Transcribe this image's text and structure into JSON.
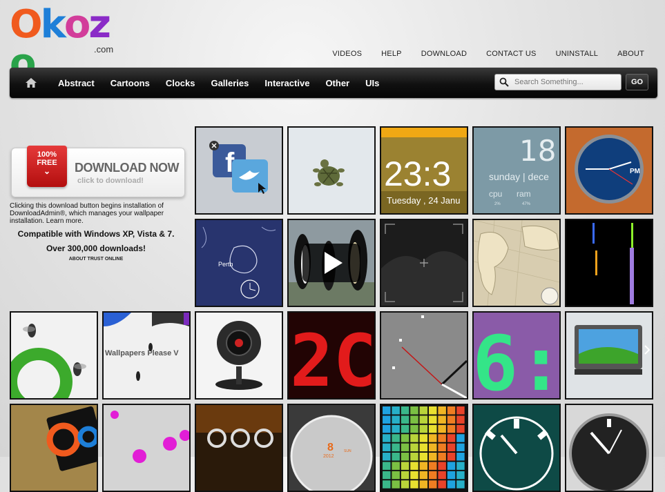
{
  "logo": {
    "letters": [
      "O",
      "k",
      "o",
      "z",
      "o"
    ],
    "suffix": ".com"
  },
  "top_links": [
    "VIDEOS",
    "HELP",
    "DOWNLOAD",
    "CONTACT US",
    "UNINSTALL",
    "ABOUT"
  ],
  "nav": {
    "items": [
      "Abstract",
      "Cartoons",
      "Clocks",
      "Galleries",
      "Interactive",
      "Other",
      "UIs"
    ]
  },
  "search": {
    "placeholder": "Search Something...",
    "button": "GO"
  },
  "download": {
    "ribbon_percent": "100%",
    "ribbon_free": "FREE",
    "title": "DOWNLOAD NOW",
    "subtitle": "click to download!",
    "description": "Clicking this download button begins installation of DownloadAdmin®, which manages your wallpaper installation. Learn more.",
    "compat": "Compatible with Windows XP, Vista & 7.",
    "downloads": "Over 300,000 downloads!",
    "trust": "ABOUT TRUST ONLINE"
  },
  "tiles": {
    "clock_time": "23:3",
    "clock_date": "Tuesday , 24 Janu",
    "weather_num": "18",
    "weather_day": "sunday | dece",
    "weather_cpu": "cpu",
    "weather_ram": "ram",
    "weather_cpu_val": "2%",
    "weather_ram_val": "47%",
    "map_city": "Perth",
    "ants_text": "Wallpapers Please V",
    "red_digits": "2C",
    "green_digits": "6:",
    "pm": "PM",
    "calendar_num": "8",
    "calendar_year": "2012",
    "calendar_day": "SUN"
  },
  "colors": {
    "navbar": "#111111",
    "logo_o": "#f05a1e",
    "logo_k": "#1e7fd8",
    "logo_z": "#8a2bc7",
    "logo_o2": "#2aa34a"
  }
}
